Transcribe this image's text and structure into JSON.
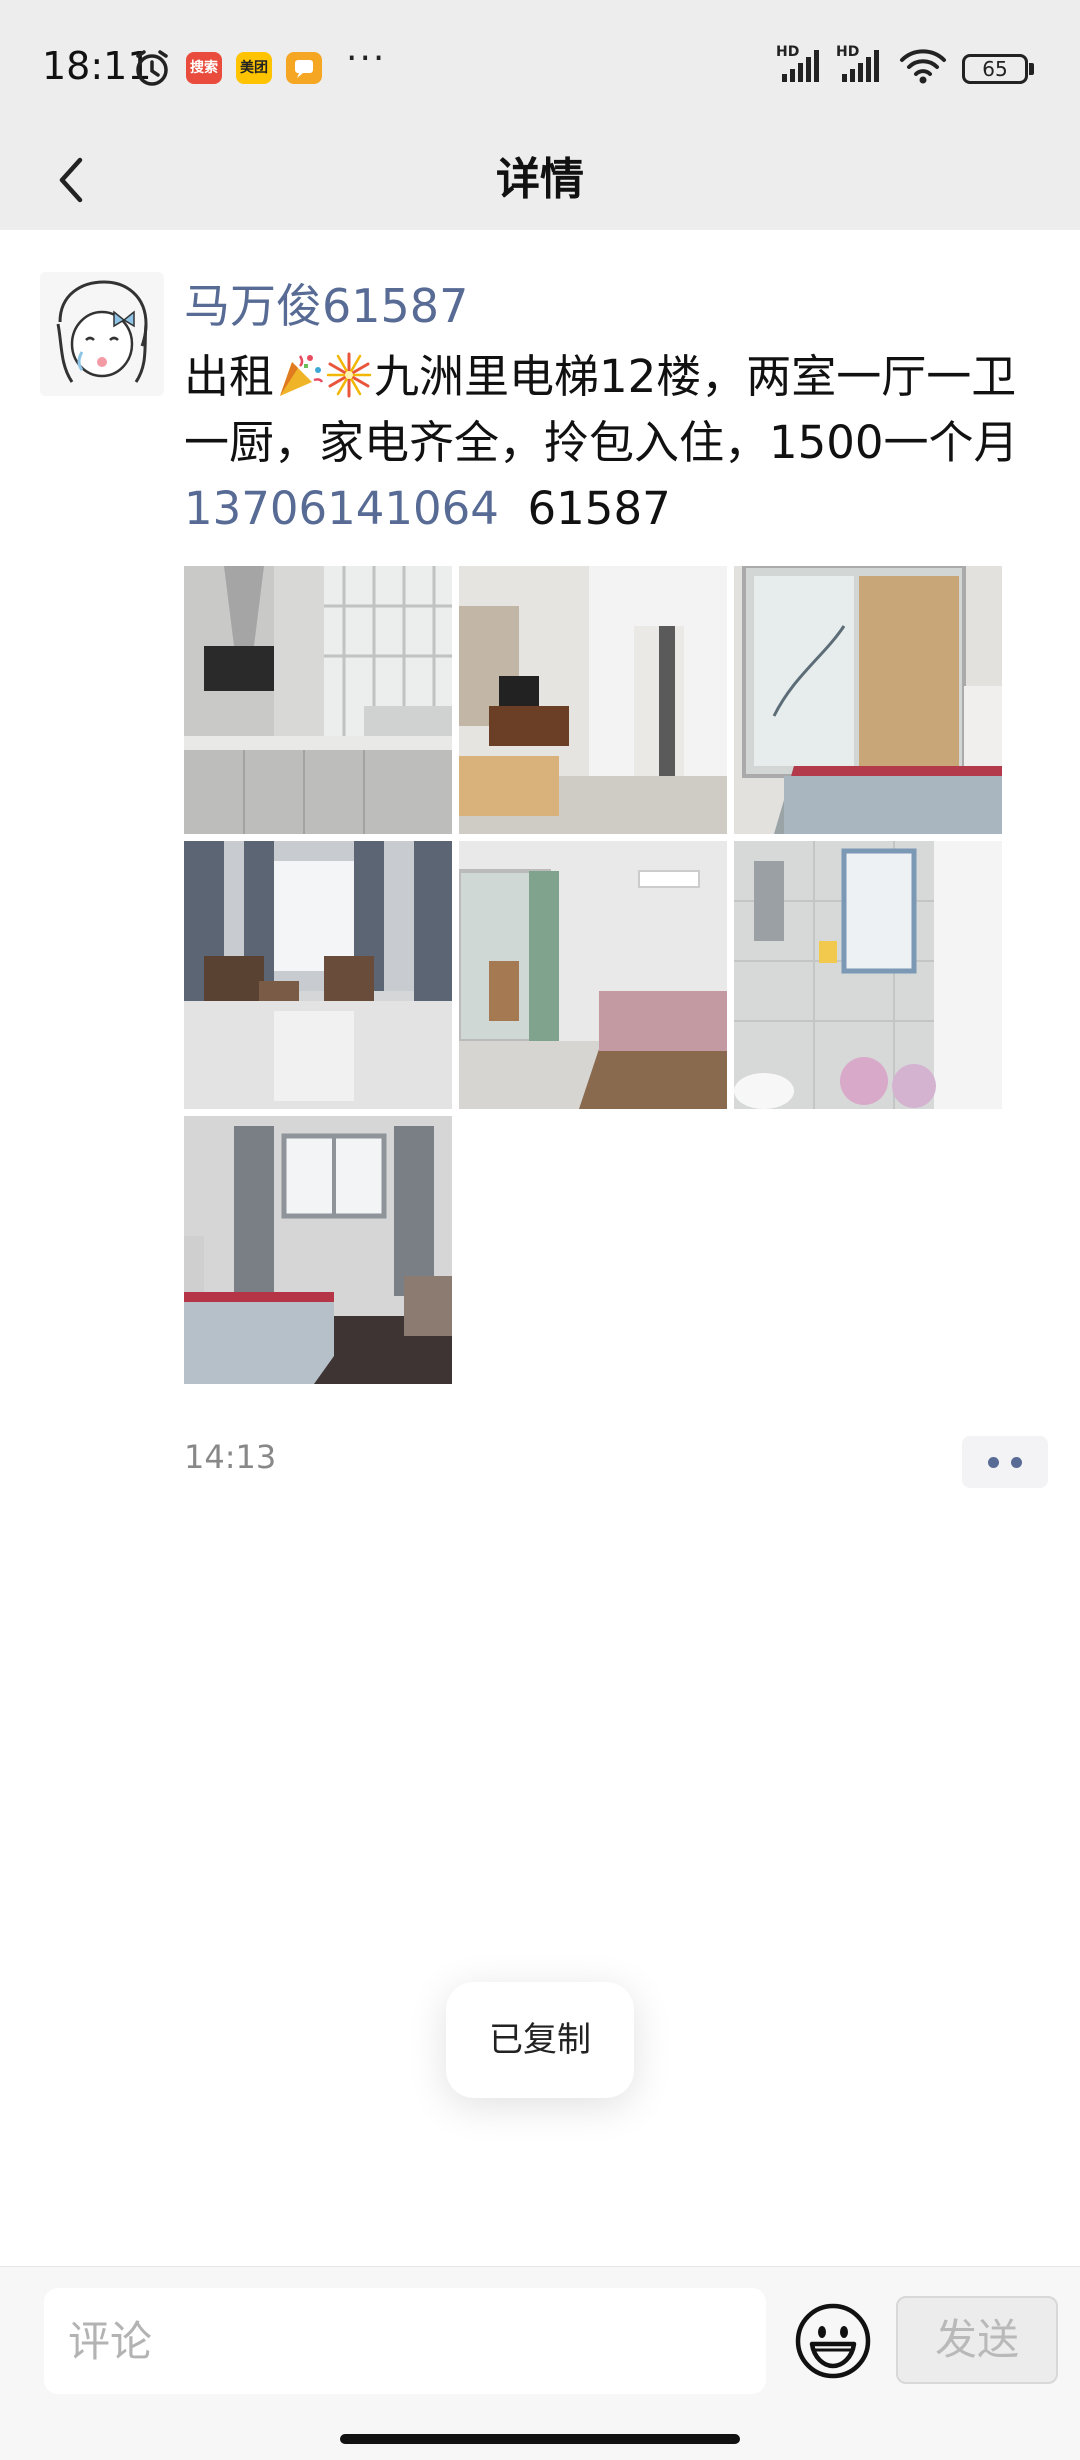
{
  "status_bar": {
    "time": "18:11",
    "apps": [
      "搜索",
      "美团",
      ""
    ],
    "more": "···",
    "network_labels": [
      "HD",
      "HD"
    ],
    "battery": "65"
  },
  "header": {
    "title": "详情"
  },
  "post": {
    "author": "马万俊61587",
    "text_part1": "出租",
    "text_part2": "九洲里电梯12楼，两室一厅一卫一厨，家电齐全，拎包入住，1500一个月",
    "phone": "13706141064",
    "code": "61587",
    "photos": [
      "kitchen",
      "bedroom-tv",
      "wardrobe-bed",
      "living-room",
      "bedroom-balcony",
      "bathroom",
      "bedroom-window"
    ],
    "time": "14:13"
  },
  "toast": "已复制",
  "bottom_bar": {
    "comment_placeholder": "评论",
    "send_label": "发送"
  },
  "colors": {
    "link": "#576b95",
    "header_bg": "#ededed"
  }
}
